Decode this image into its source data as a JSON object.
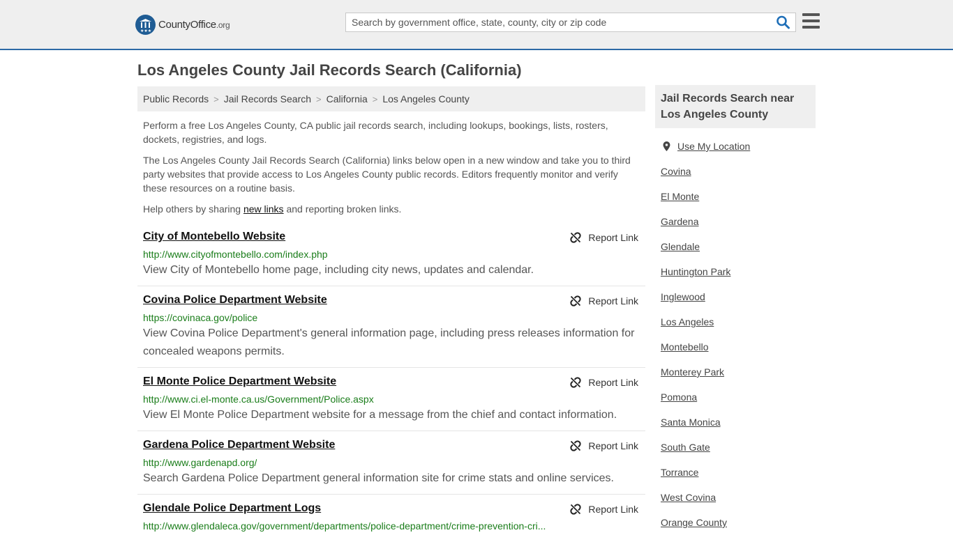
{
  "header": {
    "logo_text": "CountyOffice",
    "logo_suffix": ".org",
    "search_placeholder": "Search by government office, state, county, city or zip code"
  },
  "page_title": "Los Angeles County Jail Records Search (California)",
  "breadcrumb": [
    "Public Records",
    "Jail Records Search",
    "California",
    "Los Angeles County"
  ],
  "breadcrumb_separator": ">",
  "intro": {
    "p1": "Perform a free Los Angeles County, CA public jail records search, including lookups, bookings, lists, rosters, dockets, registries, and logs.",
    "p2": "The Los Angeles County Jail Records Search (California) links below open in a new window and take you to third party websites that provide access to Los Angeles County public records. Editors frequently monitor and verify these resources on a routine basis.",
    "p3_before": "Help others by sharing ",
    "p3_link": "new links",
    "p3_after": " and reporting broken links."
  },
  "report_label": "Report Link",
  "results": [
    {
      "title": "City of Montebello Website",
      "url": "http://www.cityofmontebello.com/index.php",
      "desc": "View City of Montebello home page, including city news, updates and calendar."
    },
    {
      "title": "Covina Police Department Website",
      "url": "https://covinaca.gov/police",
      "desc": "View Covina Police Department's general information page, including press releases information for concealed weapons permits."
    },
    {
      "title": "El Monte Police Department Website",
      "url": "http://www.ci.el-monte.ca.us/Government/Police.aspx",
      "desc": "View El Monte Police Department website for a message from the chief and contact information."
    },
    {
      "title": "Gardena Police Department Website",
      "url": "http://www.gardenapd.org/",
      "desc": "Search Gardena Police Department general information site for crime stats and online services."
    },
    {
      "title": "Glendale Police Department Logs",
      "url": "http://www.glendaleca.gov/government/departments/police-department/crime-prevention-cri...",
      "desc": ""
    }
  ],
  "sidebar": {
    "heading": "Jail Records Search near Los Angeles County",
    "use_location": "Use My Location",
    "links": [
      "Covina",
      "El Monte",
      "Gardena",
      "Glendale",
      "Huntington Park",
      "Inglewood",
      "Los Angeles",
      "Montebello",
      "Monterey Park",
      "Pomona",
      "Santa Monica",
      "South Gate",
      "Torrance",
      "West Covina",
      "Orange County"
    ]
  },
  "colors": {
    "accent": "#2c6aa6",
    "url_green": "#1a7d1a",
    "search_icon": "#1f6fb8"
  }
}
